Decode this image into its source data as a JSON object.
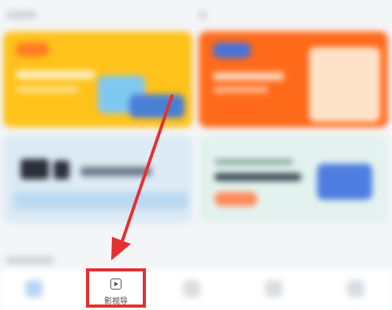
{
  "bottom_nav": {
    "highlighted_tab": {
      "label": "影视导",
      "icon": "play-icon"
    }
  },
  "annotation": {
    "highlight_color": "#e53030",
    "arrow_color": "#e53030"
  },
  "colors": {
    "banner_yellow": "#ffc21a",
    "banner_orange": "#ff6a1a",
    "card_light_blue": "#dceaf5",
    "card_light_mint": "#e3f2ee"
  }
}
